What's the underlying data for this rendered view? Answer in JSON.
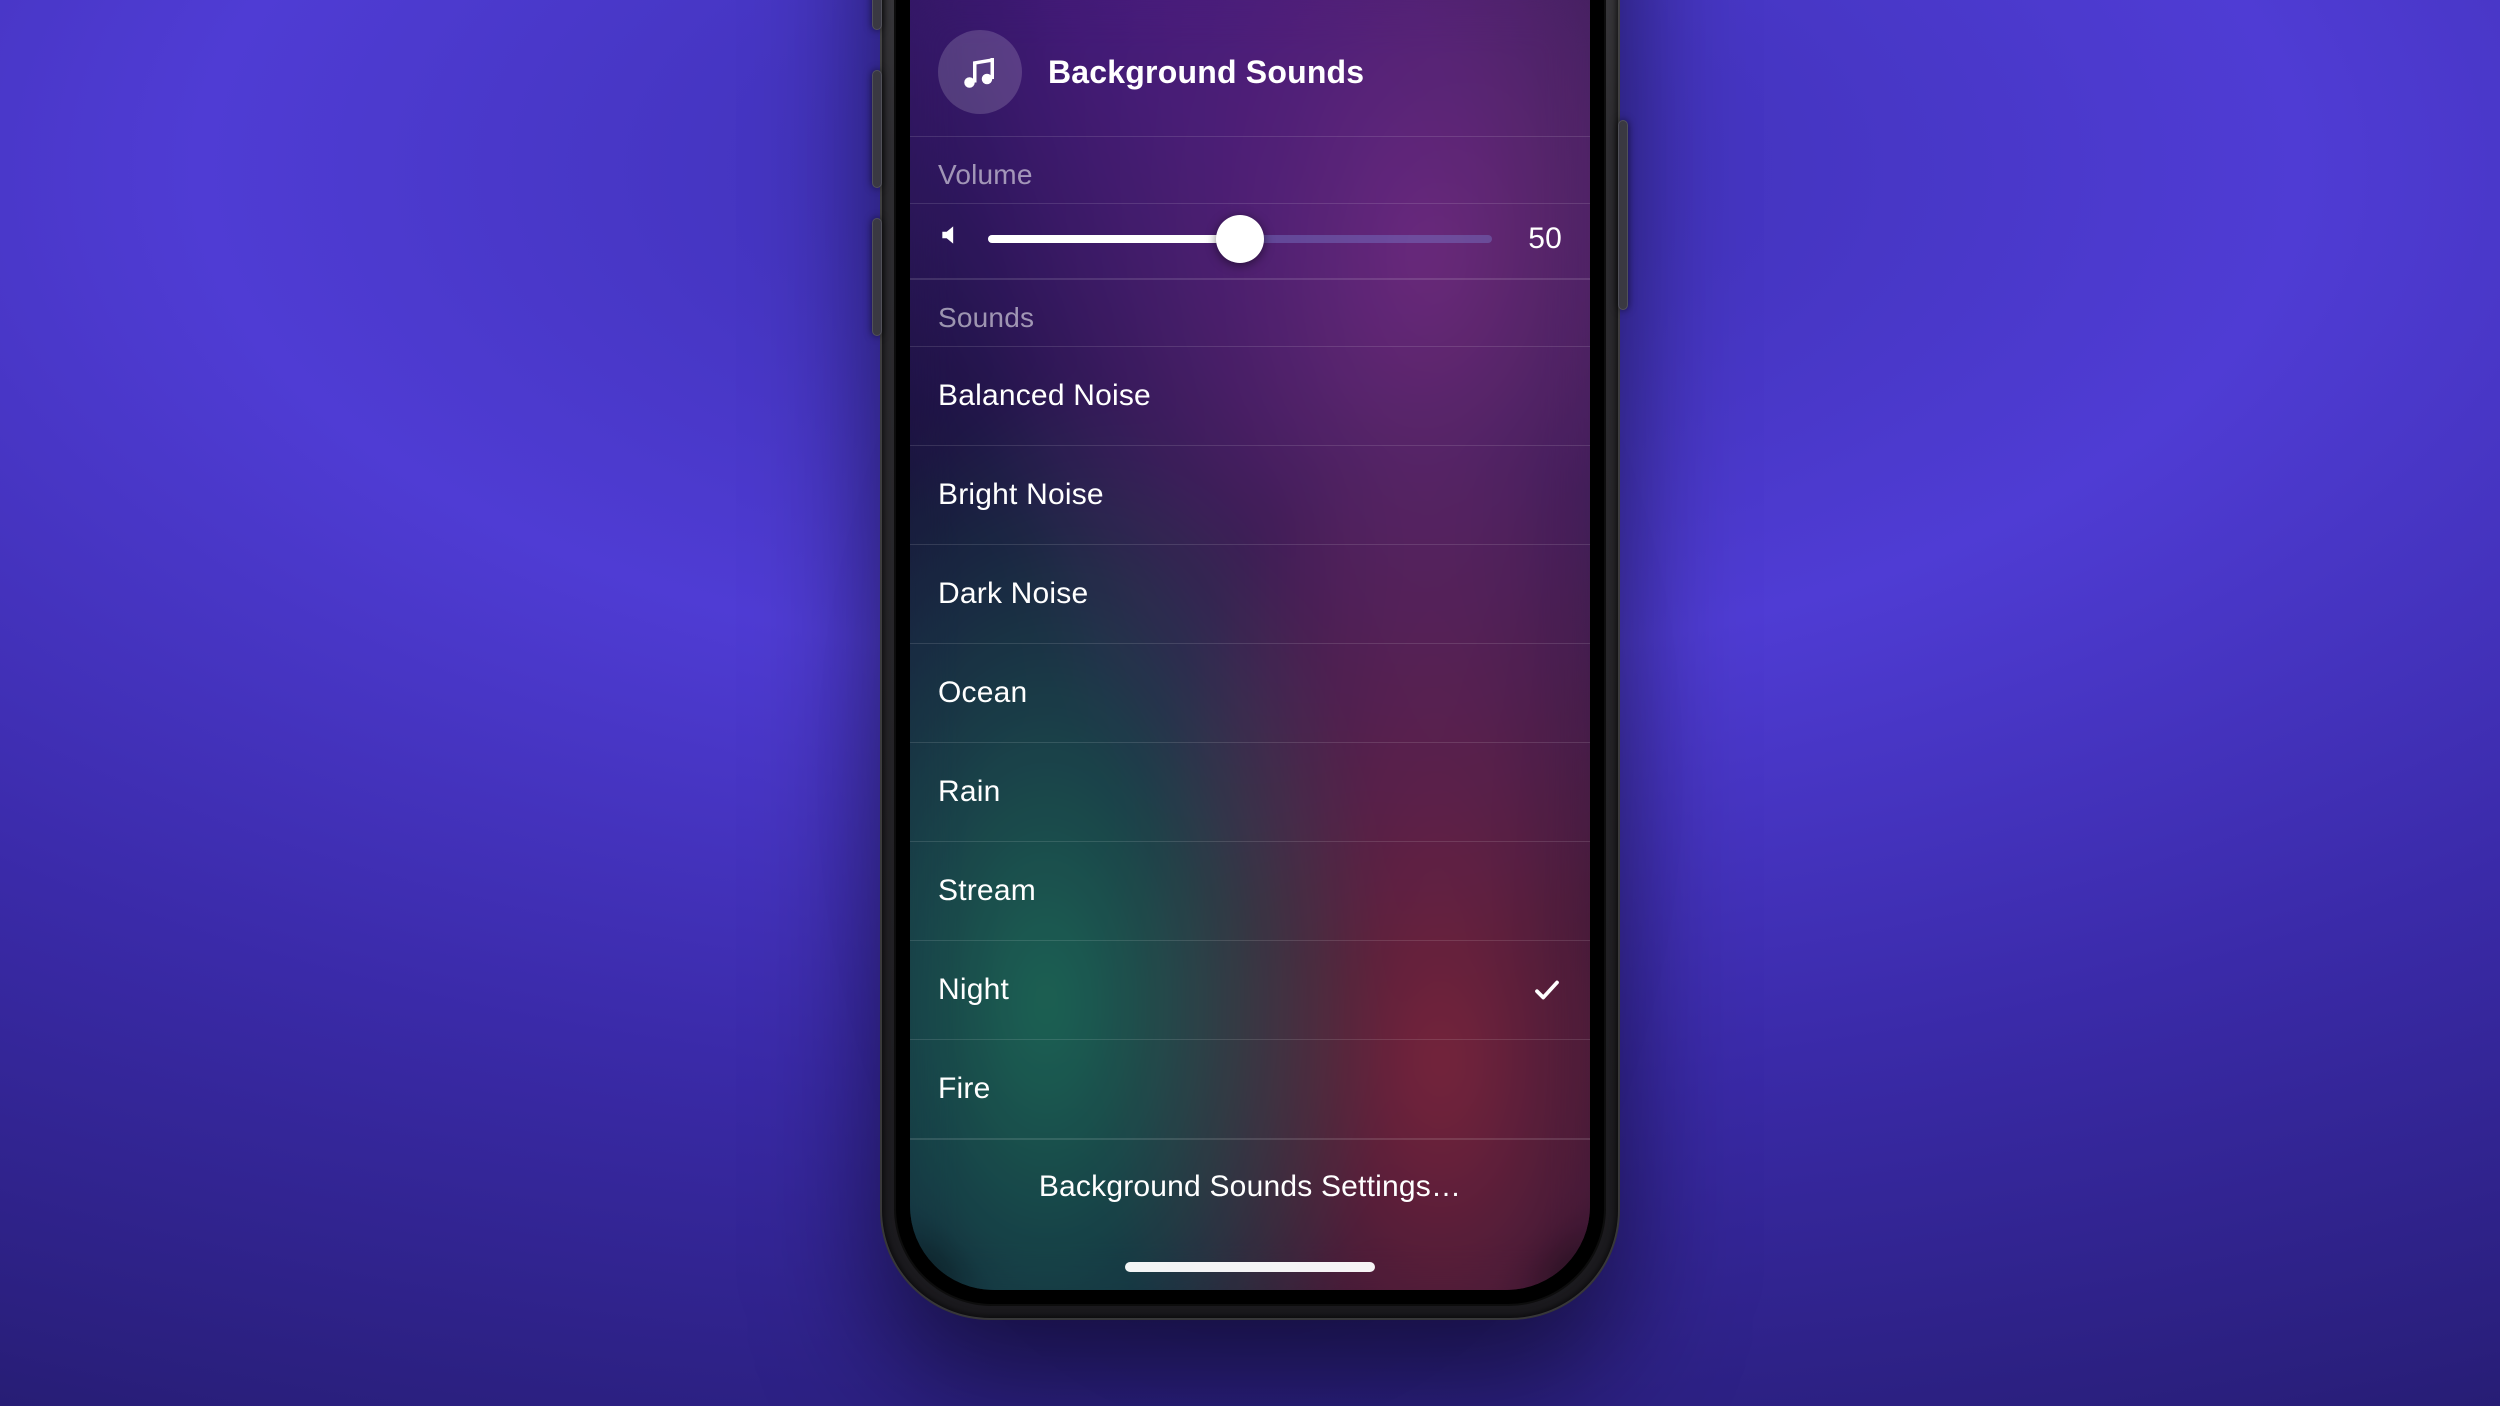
{
  "header": {
    "title": "Background Sounds",
    "icon": "music-notes-icon"
  },
  "volume": {
    "label": "Volume",
    "value": 50,
    "display": "50",
    "speaker_icon": "speaker-icon"
  },
  "sounds": {
    "label": "Sounds",
    "items": [
      {
        "label": "Balanced Noise",
        "selected": false
      },
      {
        "label": "Bright Noise",
        "selected": false
      },
      {
        "label": "Dark Noise",
        "selected": false
      },
      {
        "label": "Ocean",
        "selected": false
      },
      {
        "label": "Rain",
        "selected": false
      },
      {
        "label": "Stream",
        "selected": false
      },
      {
        "label": "Night",
        "selected": true
      },
      {
        "label": "Fire",
        "selected": false
      }
    ]
  },
  "footer": {
    "settings_label": "Background Sounds Settings…"
  },
  "colors": {
    "accent": "#6a5af0",
    "text_secondary": "rgba(255,255,255,.55)"
  }
}
